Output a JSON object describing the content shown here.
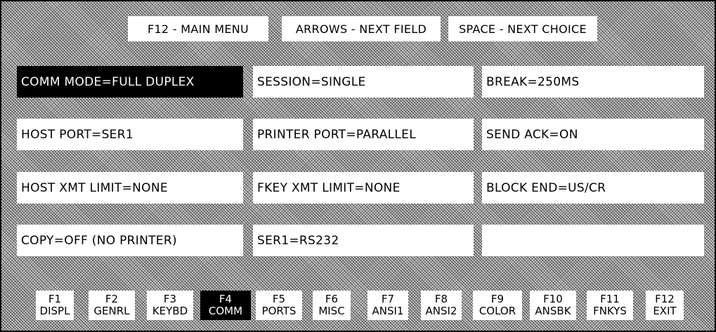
{
  "header": {
    "main_menu": "F12 - MAIN MENU",
    "arrows": "ARROWS - NEXT FIELD",
    "space": "SPACE - NEXT CHOICE"
  },
  "fields": {
    "comm_mode": "COMM MODE=FULL DUPLEX",
    "session": "SESSION=SINGLE",
    "break": "BREAK=250MS",
    "host_port": "HOST PORT=SER1",
    "printer_port": "PRINTER PORT=PARALLEL",
    "send_ack": "SEND ACK=ON",
    "host_xmt_limit": "HOST XMT LIMIT=NONE",
    "fkey_xmt_limit": "FKEY XMT LIMIT=NONE",
    "block_end": "BLOCK END=US/CR",
    "copy": "COPY=OFF (NO PRINTER)",
    "ser1": "SER1=RS232",
    "empty": ""
  },
  "fkeys": [
    {
      "key": "F1",
      "label": "DISPL"
    },
    {
      "key": "F2",
      "label": "GENRL"
    },
    {
      "key": "F3",
      "label": "KEYBD"
    },
    {
      "key": "F4",
      "label": "COMM"
    },
    {
      "key": "F5",
      "label": "PORTS"
    },
    {
      "key": "F6",
      "label": "MISC"
    },
    {
      "key": "F7",
      "label": "ANSI1"
    },
    {
      "key": "F8",
      "label": "ANSI2"
    },
    {
      "key": "F9",
      "label": "COLOR"
    },
    {
      "key": "F10",
      "label": "ANSBK"
    },
    {
      "key": "F11",
      "label": "FNKYS"
    },
    {
      "key": "F12",
      "label": "EXIT"
    }
  ],
  "selected_field": "comm_mode",
  "selected_fkey": "F4",
  "colors": {
    "background": "#cfcfcf",
    "selected": "#000000",
    "box": "#ffffff"
  }
}
